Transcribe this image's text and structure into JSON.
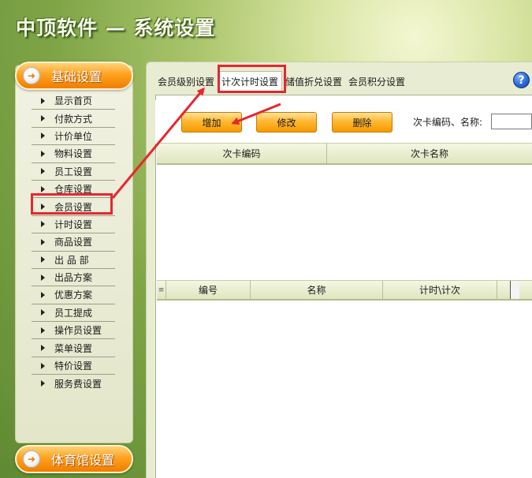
{
  "app": {
    "title": "中顶软件 — 系统设置"
  },
  "sidebar": {
    "section_top": "基础设置",
    "section_bottom": "体育馆设置",
    "items": [
      {
        "label": "显示首页"
      },
      {
        "label": "付款方式"
      },
      {
        "label": "计价单位"
      },
      {
        "label": "物料设置"
      },
      {
        "label": "员工设置"
      },
      {
        "label": "仓库设置"
      },
      {
        "label": "会员设置"
      },
      {
        "label": "计时设置"
      },
      {
        "label": "商品设置"
      },
      {
        "label": "出 品 部"
      },
      {
        "label": "出品方案"
      },
      {
        "label": "优惠方案"
      },
      {
        "label": "员工提成"
      },
      {
        "label": "操作员设置"
      },
      {
        "label": "菜单设置"
      },
      {
        "label": "特价设置"
      },
      {
        "label": "服务费设置"
      }
    ]
  },
  "tabs": [
    {
      "label": "会员级别设置"
    },
    {
      "label": "计次计时设置"
    },
    {
      "label": "储值折兑设置"
    },
    {
      "label": "会员积分设置"
    }
  ],
  "help": {
    "symbol": "?"
  },
  "toolbar": {
    "add_label": "增加",
    "edit_label": "修改",
    "delete_label": "删除",
    "search_label": "次卡编码、名称:",
    "search_value": ""
  },
  "grid1": {
    "columns": [
      "次卡编码",
      "次卡名称"
    ]
  },
  "grid2": {
    "indicator": "≡",
    "columns": [
      "编号",
      "名称",
      "计时\\计次"
    ]
  },
  "annotation_color": "#e8262f"
}
